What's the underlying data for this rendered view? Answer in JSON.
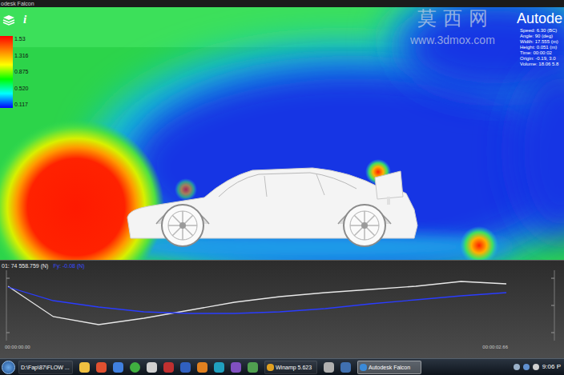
{
  "window": {
    "title": "odesk Falcon"
  },
  "toolbar": {
    "info_icon": "i"
  },
  "logo": "Autode",
  "watermark": {
    "chars": "莫 西 网",
    "url": "www.3dmox.com"
  },
  "legend": {
    "labels": [
      "1.53",
      "1.316",
      "0.875",
      "0.520",
      "0.117"
    ]
  },
  "info": [
    "Speed: 6.30 (BC)",
    "Angle: 90 (deg)",
    "Width: 17.555 (m)",
    "Height: 0.051 (m)",
    "Time: 00:00:02",
    "Origin: -0.19, 3.0",
    "Volume: 18.06 5.8"
  ],
  "chart": {
    "readouts": [
      {
        "text": "01: 74 558.759 (N)",
        "color": "#e8e8e8"
      },
      {
        "text": "Fy: -0.08 (N)",
        "color": "#3a4cff"
      }
    ],
    "series": [
      {
        "color": "#e8e8e8",
        "values": [
          68,
          30,
          20,
          28,
          38,
          48,
          55,
          60,
          64,
          68,
          74,
          71
        ]
      },
      {
        "color": "#2a3cff",
        "values": [
          67,
          50,
          42,
          36,
          34,
          34,
          36,
          40,
          46,
          51,
          56,
          60
        ]
      }
    ],
    "x_ticks": [
      "00:00:00.00",
      "00:00:02.66"
    ]
  },
  "taskbar": {
    "items": [
      {
        "label": "D:\\Fap\\87\\FLOW ...",
        "selected": false
      },
      {
        "label": "Winamp 5.623",
        "selected": false
      },
      {
        "label": "Autodesk Falcon",
        "selected": true
      }
    ],
    "clock": "9:06 P"
  }
}
